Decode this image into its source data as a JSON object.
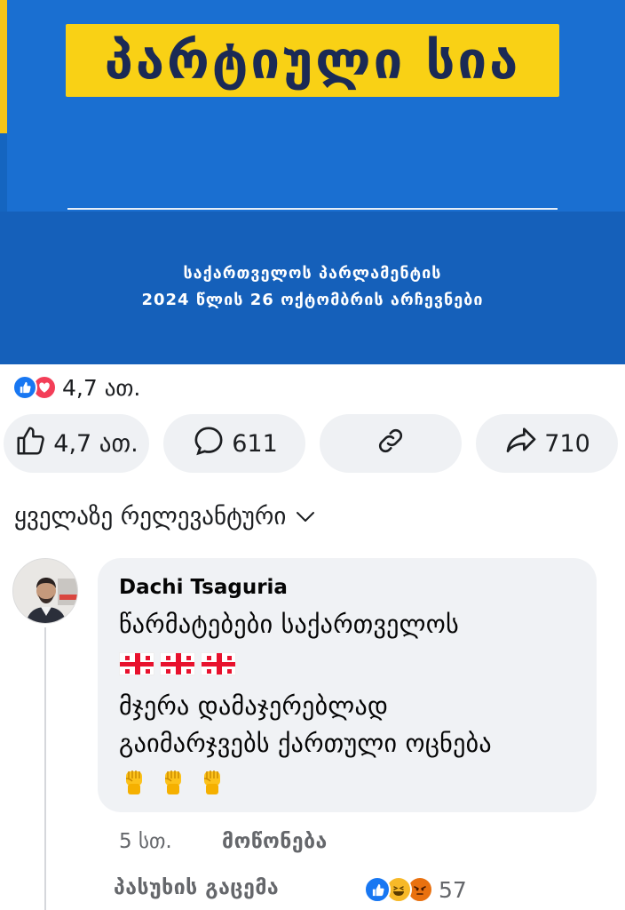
{
  "post_image": {
    "top_text": "",
    "headline": "პარტიული სია",
    "subtitle_line1": "საქართველოს პარლამენტის",
    "subtitle_line2": "2024 წლის 26 ოქტომბრის არჩევნები",
    "colors": {
      "blue": "#1a6fd1",
      "dark_blue": "#1560ba",
      "yellow": "#f9d115",
      "navy": "#1b2a55"
    }
  },
  "reaction_summary": {
    "icons": [
      "like-icon",
      "love-icon"
    ],
    "count": "4,7 ათ."
  },
  "actions": {
    "like": {
      "icon": "thumbs-up-icon",
      "label": "4,7 ათ."
    },
    "comment": {
      "icon": "comment-icon",
      "label": "611"
    },
    "copy_link": {
      "icon": "link-icon"
    },
    "share": {
      "icon": "share-arrow-icon",
      "label": "710"
    }
  },
  "sort": {
    "label": "ყველაზე რელევანტური",
    "icon": "chevron-down-icon"
  },
  "comment": {
    "author": "Dachi Tsaguria",
    "line1": "წარმატებები საქართველოს",
    "line2_emoji": [
      "georgia-flag",
      "georgia-flag",
      "georgia-flag"
    ],
    "line3": "მჯერა დამაჯერებლად",
    "line4": "გაიმარჯვებს ქართული ოცნება",
    "line5_emoji": [
      "raised-fist",
      "raised-fist",
      "raised-fist"
    ],
    "time": "5 სთ.",
    "like_label": "მოწონება",
    "reply_label": "პასუხის გაცემა",
    "reaction_icons": [
      "like-icon",
      "haha-icon",
      "angry-icon"
    ],
    "reaction_count": "57"
  },
  "colors": {
    "accent": "#1877f2",
    "pill_bg": "#eff1f4",
    "bubble_bg": "#f0f2f5",
    "muted": "#65676b"
  }
}
